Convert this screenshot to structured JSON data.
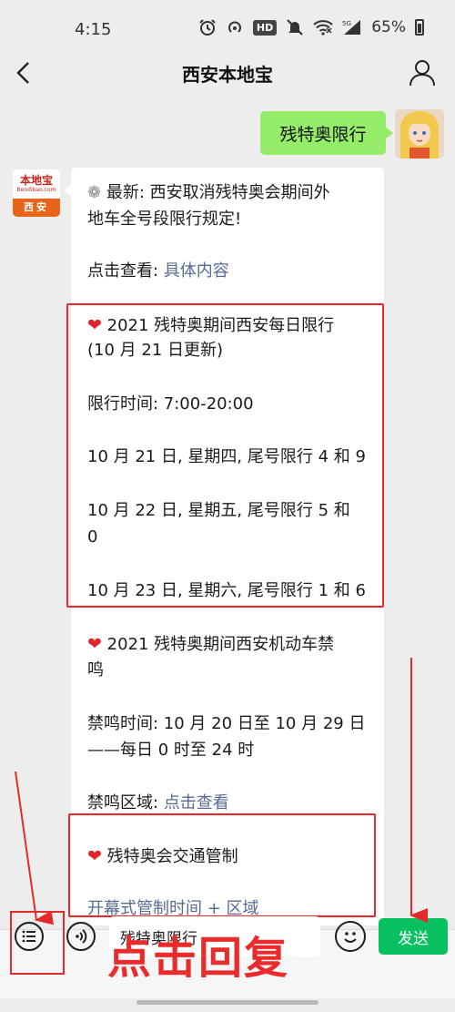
{
  "status_bar": {
    "time": "4:15",
    "hd_badge": "HD",
    "network": "5G",
    "battery": "65%"
  },
  "nav": {
    "title": "西安本地宝"
  },
  "outgoing": {
    "text": "残特奥限行"
  },
  "bot_avatar": {
    "logo_main": "本地宝",
    "logo_sub": "Bendibao.com",
    "logo_city": "西安"
  },
  "message": {
    "l1": "最新: 西安取消残特奥会期间外",
    "l2": "地车全号段限行规定!",
    "l3_label": "点击查看:",
    "l3_link": "具体内容",
    "l4": "2021 残特奥期间西安每日限行",
    "l5": "(10 月 21 日更新)",
    "l6": "限行时间: 7:00-20:00",
    "l7": "10 月 21 日, 星期四, 尾号限行 4 和 9",
    "l8": "10 月 22 日, 星期五, 尾号限行 5 和",
    "l9": "0",
    "l10": "10 月 23 日, 星期六, 尾号限行 1 和 6",
    "l11": "2021 残特奥期间西安机动车禁",
    "l12": "鸣",
    "l13": "禁鸣时间: 10 月 20 日至 10 月 29 日",
    "l14": "——每日 0 时至 24 时",
    "l15_label": "禁鸣区域:",
    "l15_link": "点击查看",
    "l16": "残特奥会交通管制",
    "l17_link": "开幕式管制时间 + 区域"
  },
  "input_bar": {
    "input_value": "残特奥限行",
    "send_label": "发送"
  },
  "annotation": {
    "text": "点击回复"
  },
  "colors": {
    "background": "#ededed",
    "outgoing_bubble": "#95ec69",
    "link": "#576b95",
    "send_button": "#07c160",
    "annotation_red": "#e52a2a"
  }
}
